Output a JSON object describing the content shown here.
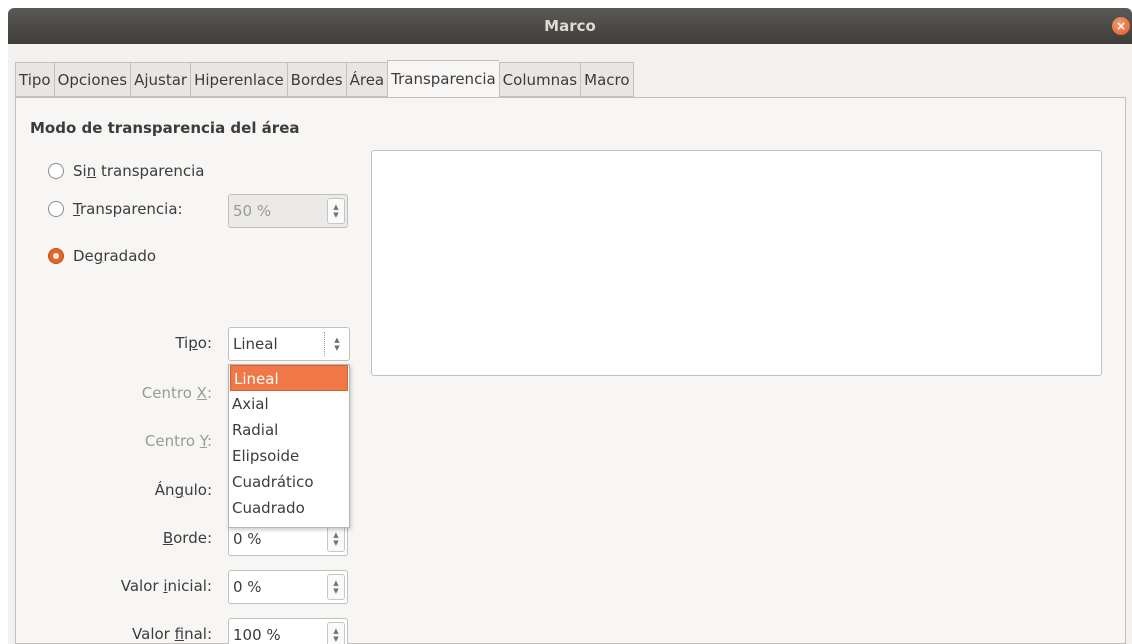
{
  "window": {
    "title": "Marco",
    "close_glyph": "×"
  },
  "tabs": [
    {
      "label": "Tipo"
    },
    {
      "label": "Opciones"
    },
    {
      "label": "Ajustar"
    },
    {
      "label": "Hiperenlace"
    },
    {
      "label": "Bordes"
    },
    {
      "label": "Área"
    },
    {
      "label": "Transparencia",
      "active": true
    },
    {
      "label": "Columnas"
    },
    {
      "label": "Macro"
    }
  ],
  "section": {
    "heading": "Modo de transparencia del área"
  },
  "modes": {
    "none": {
      "pre": "Si",
      "mnemonic": "n",
      "post": " transparencia",
      "checked": false
    },
    "transparency": {
      "pre": "",
      "mnemonic": "T",
      "post": "ransparencia:",
      "checked": false,
      "value": "50 %"
    },
    "gradient": {
      "pre": "De",
      "mnemonic": "g",
      "post": "radado",
      "checked": true
    }
  },
  "gradient": {
    "type_label": {
      "pre": "Ti",
      "mnemonic": "p",
      "post": "o:"
    },
    "type_value": "Lineal",
    "type_options": [
      "Lineal",
      "Axial",
      "Radial",
      "Elipsoide",
      "Cuadrático",
      "Cuadrado"
    ],
    "selected_option": "Lineal",
    "center_x_label": {
      "pre": "Centro ",
      "mnemonic": "X",
      "post": ":"
    },
    "center_y_label": {
      "pre": "Centro ",
      "mnemonic": "Y",
      "post": ":"
    },
    "angle_label": {
      "pre": "Án",
      "mnemonic": "g",
      "post": "ulo:"
    },
    "border_label": {
      "pre": "",
      "mnemonic": "B",
      "post": "orde:"
    },
    "border_value": "0 %",
    "start_label": {
      "pre": "Valor ",
      "mnemonic": "i",
      "post": "nicial:"
    },
    "start_value": "0 %",
    "end_label": {
      "pre": "Valor ",
      "mnemonic": "f",
      "post": "inal:"
    },
    "end_value": "100 %"
  },
  "colors": {
    "accent": "#e4662a",
    "selection": "#f07746",
    "titlebar": "#3e3d39"
  }
}
